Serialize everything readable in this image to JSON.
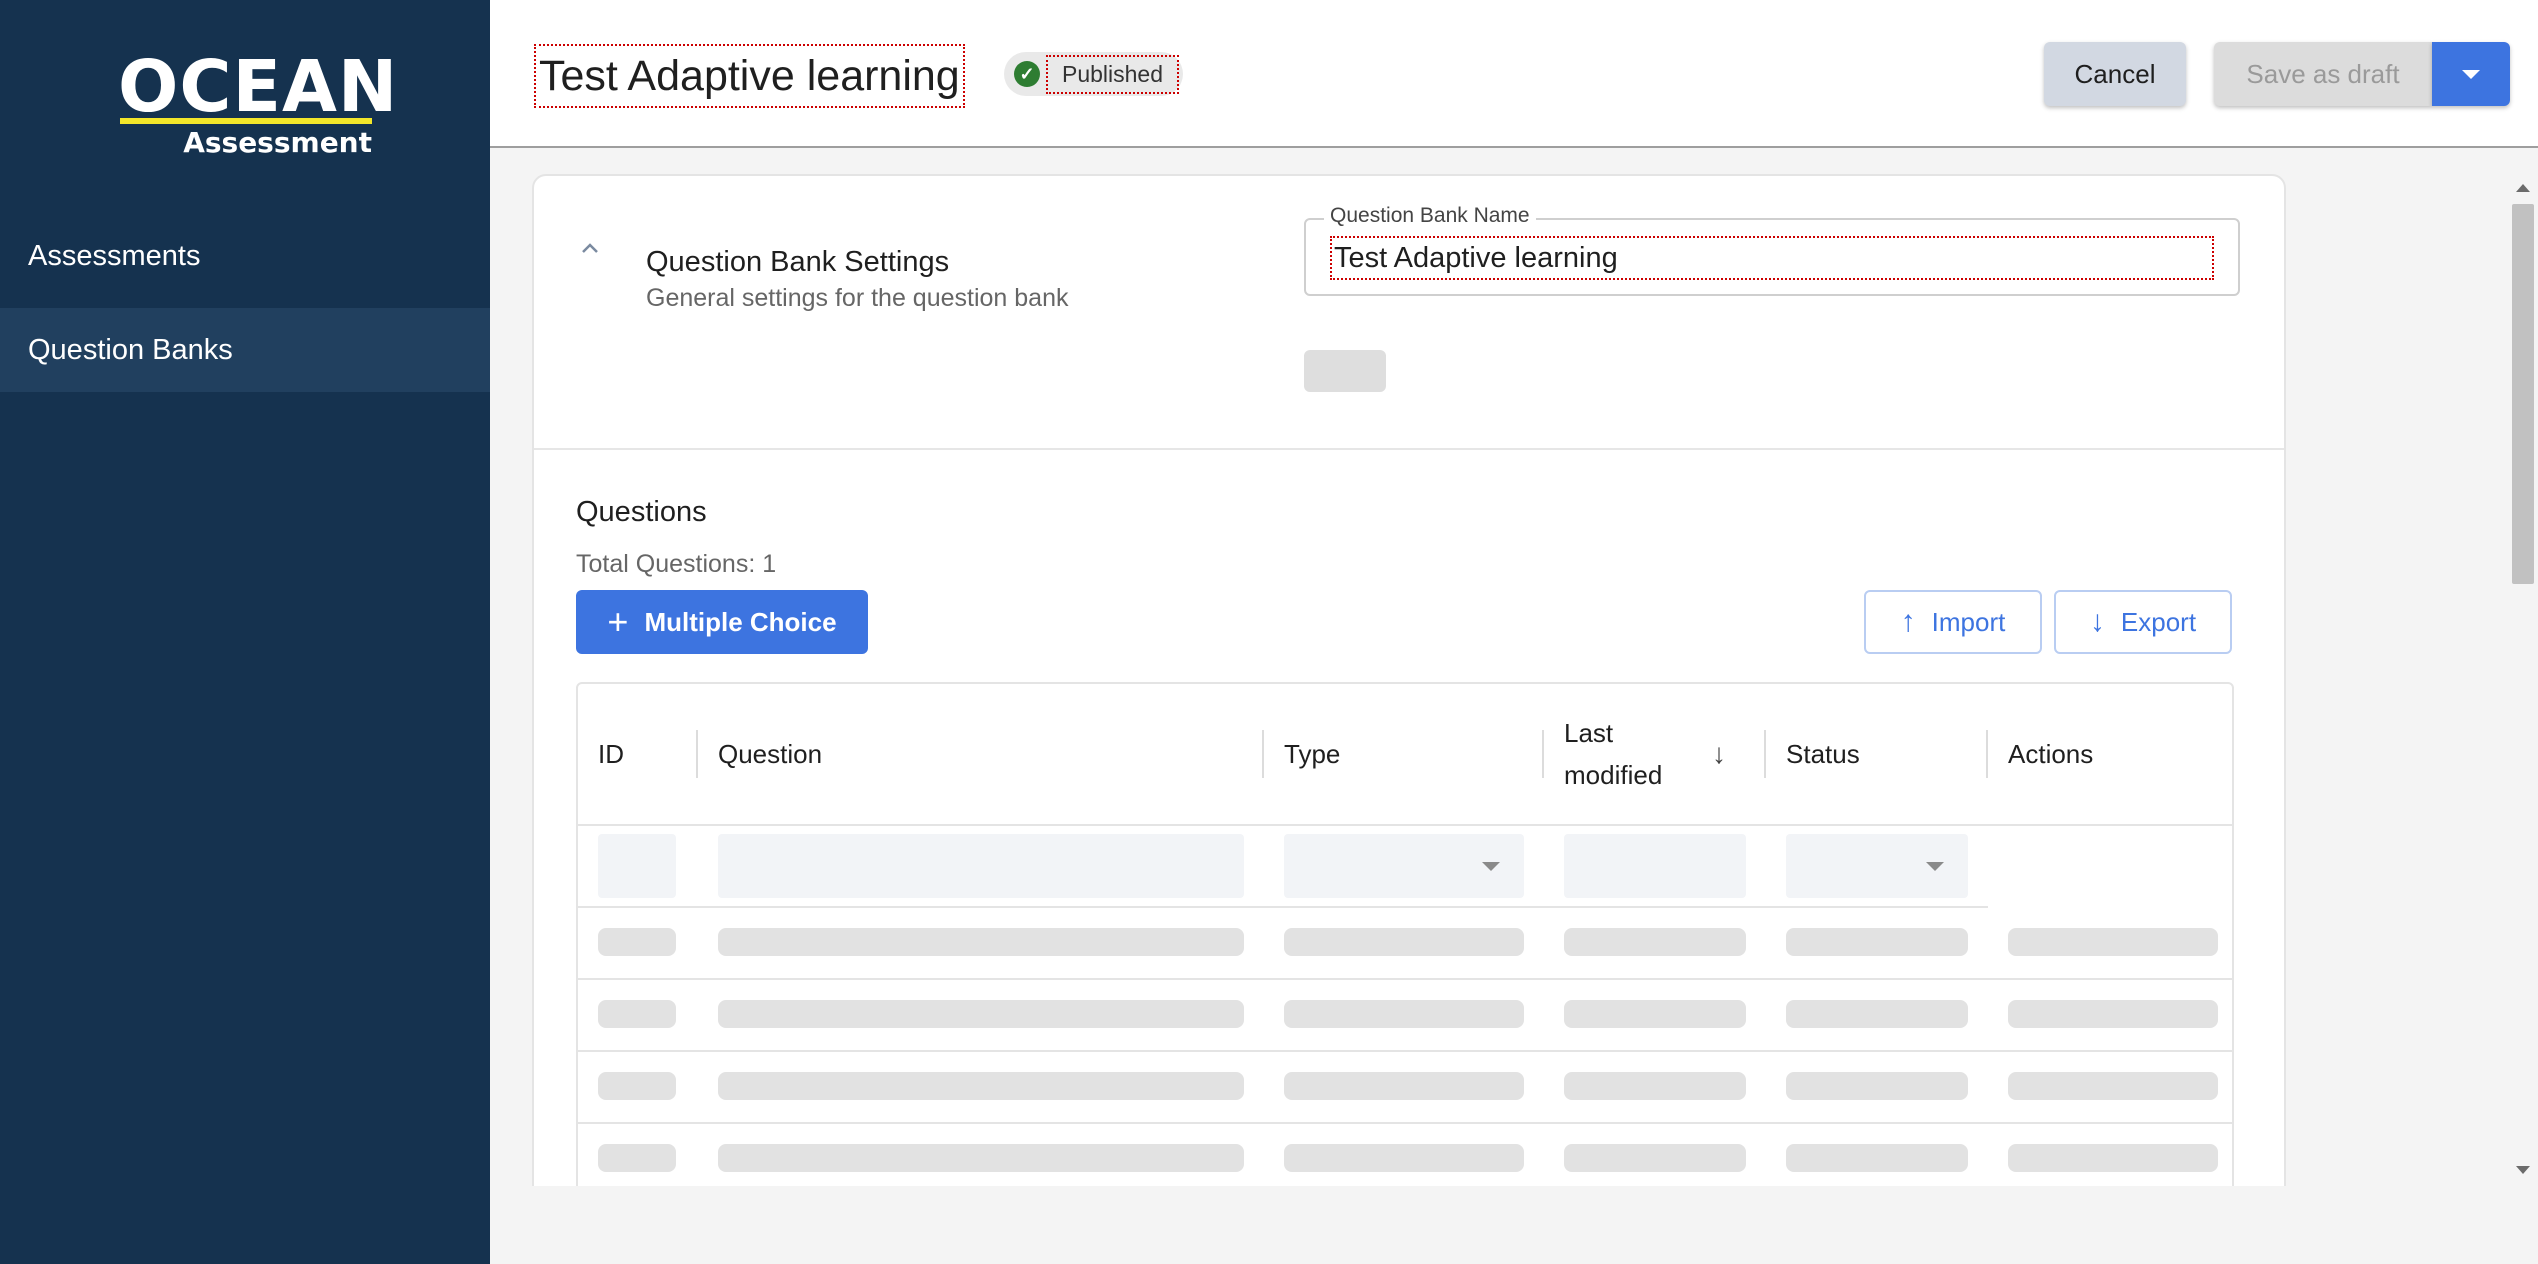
{
  "sidebar": {
    "logo": {
      "word": "OCEAN",
      "sub": "Assessment"
    },
    "items": [
      {
        "label": "Assessments",
        "active": false
      },
      {
        "label": "Question Banks",
        "active": true
      }
    ]
  },
  "header": {
    "title": "Test Adaptive learning",
    "status": "Published",
    "cancel_label": "Cancel",
    "draft_label": "Save as draft"
  },
  "settings": {
    "title": "Question Bank Settings",
    "subtitle": "General settings for the question bank",
    "name_label": "Question Bank Name",
    "name_value": "Test Adaptive learning"
  },
  "questions": {
    "title": "Questions",
    "total": "Total Questions: 1",
    "add_label": "Multiple Choice",
    "import_label": "Import",
    "export_label": "Export",
    "columns": [
      "ID",
      "Question",
      "Type",
      "Last modified",
      "Status",
      "Actions"
    ],
    "sorted_column": "Last modified",
    "sort_direction": "descending",
    "loading_rows": 4
  },
  "colors": {
    "sidebar_bg": "#15324f",
    "accent": "#3d74e0",
    "logo_bar": "#f2e62a",
    "status_green": "#2e7d32"
  }
}
